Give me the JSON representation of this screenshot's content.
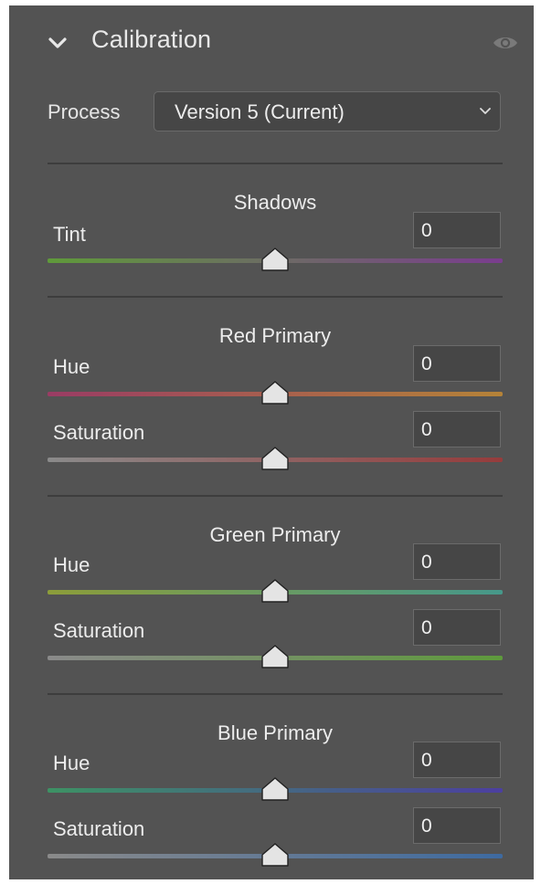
{
  "panel": {
    "title": "Calibration",
    "icons": {
      "collapse": "chevron-down-icon",
      "visibility": "eye-icon"
    }
  },
  "process": {
    "label": "Process",
    "selected": "Version 5 (Current)",
    "caret_icon": "chevron-down-icon"
  },
  "sections": [
    {
      "title": "Shadows",
      "sliders": [
        {
          "label": "Tint",
          "value": "0",
          "position": 0.5,
          "colors": [
            "#5f9a3a",
            "#7a3d8e"
          ]
        }
      ]
    },
    {
      "title": "Red Primary",
      "sliders": [
        {
          "label": "Hue",
          "value": "0",
          "position": 0.5,
          "colors": [
            "#9a3c64",
            "#b58338"
          ]
        },
        {
          "label": "Saturation",
          "value": "0",
          "position": 0.5,
          "colors": [
            "#8a8a8a",
            "#963c3c"
          ]
        }
      ]
    },
    {
      "title": "Green Primary",
      "sliders": [
        {
          "label": "Hue",
          "value": "0",
          "position": 0.5,
          "colors": [
            "#8c9d3a",
            "#46988a"
          ]
        },
        {
          "label": "Saturation",
          "value": "0",
          "position": 0.5,
          "colors": [
            "#8a8a8a",
            "#5e9a3c"
          ]
        }
      ]
    },
    {
      "title": "Blue Primary",
      "sliders": [
        {
          "label": "Hue",
          "value": "0",
          "position": 0.5,
          "colors": [
            "#3d9264",
            "#4c3fa0"
          ]
        },
        {
          "label": "Saturation",
          "value": "0",
          "position": 0.5,
          "colors": [
            "#8a8a8a",
            "#3e6aa0"
          ]
        }
      ]
    }
  ]
}
